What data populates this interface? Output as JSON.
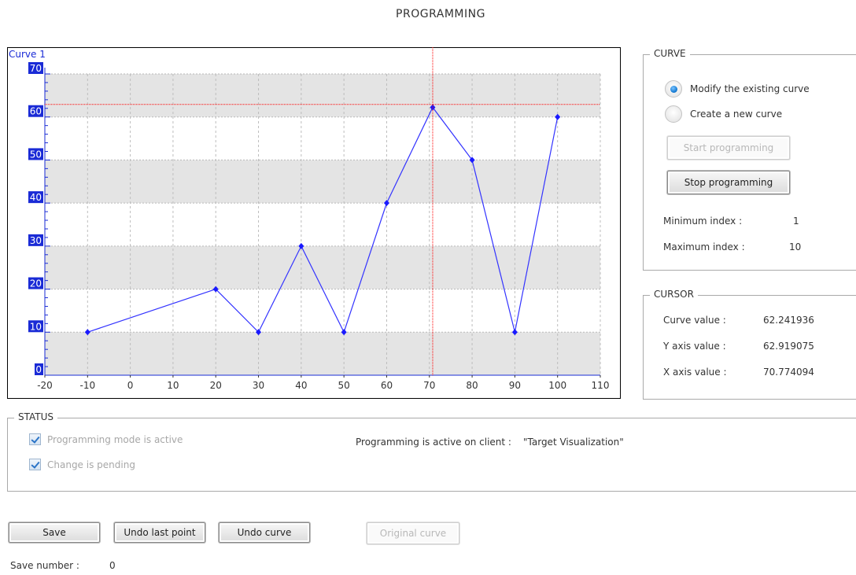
{
  "title": "PROGRAMMING",
  "chart": {
    "curve_label": "Curve 1",
    "x_ticks": [
      "-20",
      "-10",
      "0",
      "10",
      "20",
      "30",
      "40",
      "50",
      "60",
      "70",
      "80",
      "90",
      "100",
      "110"
    ],
    "y_ticks": [
      "0",
      "10",
      "20",
      "30",
      "40",
      "50",
      "60",
      "70"
    ],
    "line_color": "#3333ff",
    "cursor_color": "#ff0000"
  },
  "chart_data": {
    "type": "line",
    "series": [
      {
        "name": "Curve 1",
        "x": [
          -10,
          20,
          30,
          40,
          50,
          60,
          70.77,
          80,
          90,
          100
        ],
        "y": [
          10,
          20,
          10,
          30,
          10,
          40,
          62.24,
          50,
          10,
          60
        ]
      }
    ],
    "xlim": [
      -20,
      110
    ],
    "ylim": [
      0,
      70
    ],
    "cursor": {
      "x": 70.774094,
      "y": 62.919075
    },
    "grid": true,
    "banded_background": true
  },
  "curve_group": {
    "legend": "CURVE",
    "radio_modify": "Modify the existing curve",
    "radio_create": "Create a new curve",
    "start_button": "Start programming",
    "stop_button": "Stop programming",
    "min_index_label": "Minimum index :",
    "min_index_value": "1",
    "max_index_label": "Maximum index :",
    "max_index_value": "10"
  },
  "cursor_group": {
    "legend": "CURSOR",
    "curve_value_label": "Curve value :",
    "curve_value": "62.241936",
    "y_axis_label": "Y axis value :",
    "y_axis_value": "62.919075",
    "x_axis_label": "X axis value :",
    "x_axis_value": "70.774094"
  },
  "status_group": {
    "legend": "STATUS",
    "mode_active": "Programming mode is active",
    "change_pending": "Change is pending",
    "client_label": "Programming is active on client :",
    "client_value": "\"Target Visualization\""
  },
  "buttons": {
    "save": "Save",
    "undo_last_point": "Undo last point",
    "undo_curve": "Undo curve",
    "original_curve": "Original curve"
  },
  "save_number": {
    "label": "Save number :",
    "value": "0"
  }
}
